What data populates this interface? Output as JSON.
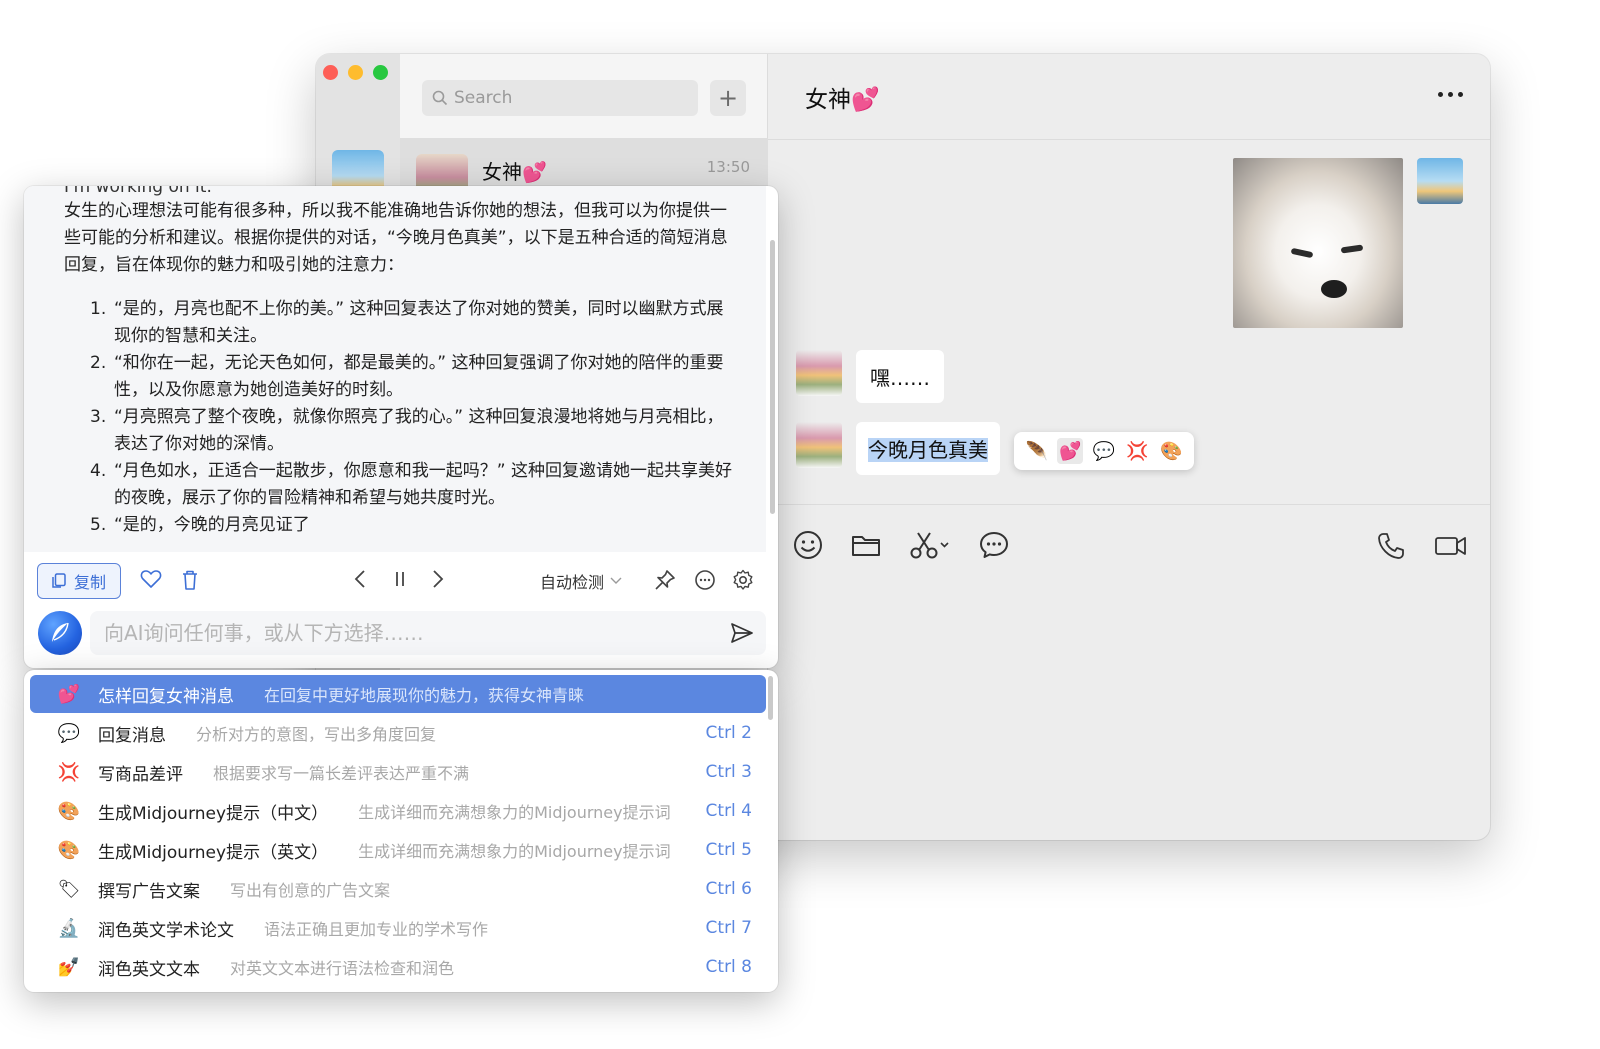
{
  "chat_window": {
    "search_placeholder": "Search",
    "add_label": "+",
    "contact": {
      "name": "女神💕",
      "time": "13:50"
    },
    "chat_title": "女神💕",
    "messages": [
      {
        "from": "peer",
        "text": "嘿……"
      },
      {
        "from": "peer",
        "text": "今晚月色真美"
      }
    ],
    "quick_actions": [
      {
        "icon": "feather-icon",
        "glyph": "🪶"
      },
      {
        "icon": "two-hearts-icon",
        "glyph": "💕"
      },
      {
        "icon": "speech-bubble-icon",
        "glyph": "💬"
      },
      {
        "icon": "anger-icon",
        "glyph": "💢"
      },
      {
        "icon": "palette-icon",
        "glyph": "🎨"
      }
    ]
  },
  "ai_panel": {
    "cut_line": "I'm working on it.",
    "intro": "女生的心理想法可能有很多种，所以我不能准确地告诉你她的想法，但我可以为你提供一些可能的分析和建议。根据你提供的对话，“今晚月色真美”，以下是五种合适的简短消息回复，旨在体现你的魅力和吸引她的注意力：",
    "items": [
      {
        "num": "1.",
        "text": "“是的，月亮也配不上你的美。” 这种回复表达了你对她的赞美，同时以幽默方式展现你的智慧和关注。"
      },
      {
        "num": "2.",
        "text": "“和你在一起，无论天色如何，都是最美的。” 这种回复强调了你对她的陪伴的重要性，以及你愿意为她创造美好的时刻。"
      },
      {
        "num": "3.",
        "text": "“月亮照亮了整个夜晚，就像你照亮了我的心。” 这种回复浪漫地将她与月亮相比，表达了你对她的深情。"
      },
      {
        "num": "4.",
        "text": "“月色如水，正适合一起散步，你愿意和我一起吗？” 这种回复邀请她一起共享美好的夜晚，展示了你的冒险精神和希望与她共度时光。"
      },
      {
        "num": "5.",
        "text": "“是的，今晚的月亮见证了"
      }
    ],
    "copy_label": "复制",
    "language_select": "自动检测",
    "ask_placeholder": "向AI询问任何事，或从下方选择……"
  },
  "commands": [
    {
      "glyph": "💕",
      "icon": "two-hearts-icon",
      "name": "怎样回复女神消息",
      "desc": "在回复中更好地展现你的魅力，获得女神青睐",
      "shortcut": "",
      "selected": true
    },
    {
      "glyph": "💬",
      "icon": "speech-bubble-icon",
      "name": "回复消息",
      "desc": "分析对方的意图，写出多角度回复",
      "shortcut": "Ctrl 2"
    },
    {
      "glyph": "💢",
      "icon": "anger-icon",
      "name": "写商品差评",
      "desc": "根据要求写一篇长差评表达严重不满",
      "shortcut": "Ctrl 3"
    },
    {
      "glyph": "🎨",
      "icon": "palette-icon",
      "name": "生成Midjourney提示（中文）",
      "desc": "生成详细而充满想象力的Midjourney提示词",
      "shortcut": "Ctrl 4"
    },
    {
      "glyph": "🎨",
      "icon": "palette-icon",
      "name": "生成Midjourney提示（英文）",
      "desc": "生成详细而充满想象力的Midjourney提示词",
      "shortcut": "Ctrl 5"
    },
    {
      "glyph": "🏷",
      "icon": "label-icon",
      "name": "撰写广告文案",
      "desc": "写出有创意的广告文案",
      "shortcut": "Ctrl 6"
    },
    {
      "glyph": "🔬",
      "icon": "microscope-icon",
      "name": "润色英文学术论文",
      "desc": "语法正确且更加专业的学术写作",
      "shortcut": "Ctrl 7"
    },
    {
      "glyph": "💅",
      "icon": "polish-icon",
      "name": "润色英文文本",
      "desc": "对英文文本进行语法检查和润色",
      "shortcut": "Ctrl 8"
    }
  ],
  "colors": {
    "accent": "#5b87e0",
    "chat_bg": "#ededed",
    "highlight": "#b9d4f6"
  }
}
